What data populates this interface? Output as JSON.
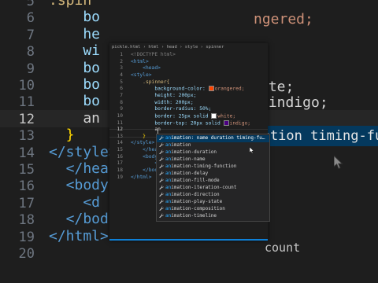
{
  "background_editor": {
    "line_numbers": [
      "5",
      "6",
      "7",
      "8",
      "9",
      "10",
      "11",
      "12",
      "13",
      "14",
      "15",
      "16",
      "17",
      "18",
      "19",
      "20"
    ],
    "lines": [
      {
        "text": ".spin",
        "cls": "tok-sel"
      },
      {
        "text": "    bo",
        "cls": "tok-prop"
      },
      {
        "text": "    he",
        "cls": "tok-prop"
      },
      {
        "text": "    wi",
        "cls": "tok-prop"
      },
      {
        "text": "    bo",
        "cls": "tok-prop"
      },
      {
        "text": "    bo",
        "cls": "tok-prop"
      },
      {
        "text": "    bo",
        "cls": "tok-prop"
      },
      {
        "text": "    an",
        "cls": "tok-white"
      },
      {
        "text": "  }",
        "cls": "tok-bracket"
      },
      {
        "text": "</style>",
        "cls": "tok-tag"
      },
      {
        "text": "  </head",
        "cls": "tok-tag"
      },
      {
        "text": "  <body",
        "cls": "tok-tag"
      },
      {
        "text": "    <d",
        "cls": "tok-tag"
      },
      {
        "text": "  </bod",
        "cls": "tok-tag"
      },
      {
        "text": "</html>",
        "cls": "tok-tag"
      },
      {
        "text": "",
        "cls": "tok-white"
      }
    ],
    "right_fragments": [
      "ngered;",
      "ite;",
      "lindigo;",
      "duration timing-fu",
      "count"
    ]
  },
  "breadcrumbs": [
    "pickle.html",
    "html",
    "head",
    "style",
    "spinner"
  ],
  "editor": {
    "line_numbers": [
      "1",
      "2",
      "3",
      "4",
      "5",
      "6",
      "7",
      "8",
      "9",
      "10",
      "11",
      "12",
      "13",
      "14",
      "15",
      "16",
      "17",
      "18",
      "19"
    ],
    "lines": [
      "<!DOCTYPE html>",
      "<html>",
      "    <head>",
      "<style>",
      "    .spinner{",
      "        background-color: ",
      "        height: 200px;",
      "        width: 200px;",
      "        border-radius: 50%;",
      "        border: 25px solid ",
      "        border-top: 20px solid ",
      "        an",
      "    }",
      "</style>",
      "    </head",
      "    <body",
      "        <d",
      "    </body",
      "</html>"
    ],
    "color_values": {
      "orangered": "orangered;",
      "white": "white;",
      "indigo": "indigo;"
    },
    "swatch_colors": {
      "orangered": "#ff4500",
      "white": "#ffffff",
      "indigo": "#4b0082"
    }
  },
  "suggestions": [
    {
      "label": "animation: name duration timing-fu…",
      "match": "an",
      "rest": "imation: name duration timing-fu…",
      "selected": true
    },
    {
      "label": "animation",
      "match": "an",
      "rest": "imation"
    },
    {
      "label": "animation-duration",
      "match": "an",
      "rest": "imation-duration"
    },
    {
      "label": "animation-name",
      "match": "an",
      "rest": "imation-name"
    },
    {
      "label": "animation-timing-function",
      "match": "an",
      "rest": "imation-timing-function"
    },
    {
      "label": "animation-delay",
      "match": "an",
      "rest": "imation-delay"
    },
    {
      "label": "animation-fill-mode",
      "match": "an",
      "rest": "imation-fill-mode"
    },
    {
      "label": "animation-iteration-count",
      "match": "an",
      "rest": "imation-iteration-count"
    },
    {
      "label": "animation-direction",
      "match": "an",
      "rest": "imation-direction"
    },
    {
      "label": "animation-play-state",
      "match": "an",
      "rest": "imation-play-state"
    },
    {
      "label": "animation-composition",
      "match": "an",
      "rest": "imation-composition"
    },
    {
      "label": "animation-timeline",
      "match": "an",
      "rest": "imation-timeline"
    }
  ],
  "icons": [
    "wrench-icon",
    "mouse-pointer-icon"
  ]
}
